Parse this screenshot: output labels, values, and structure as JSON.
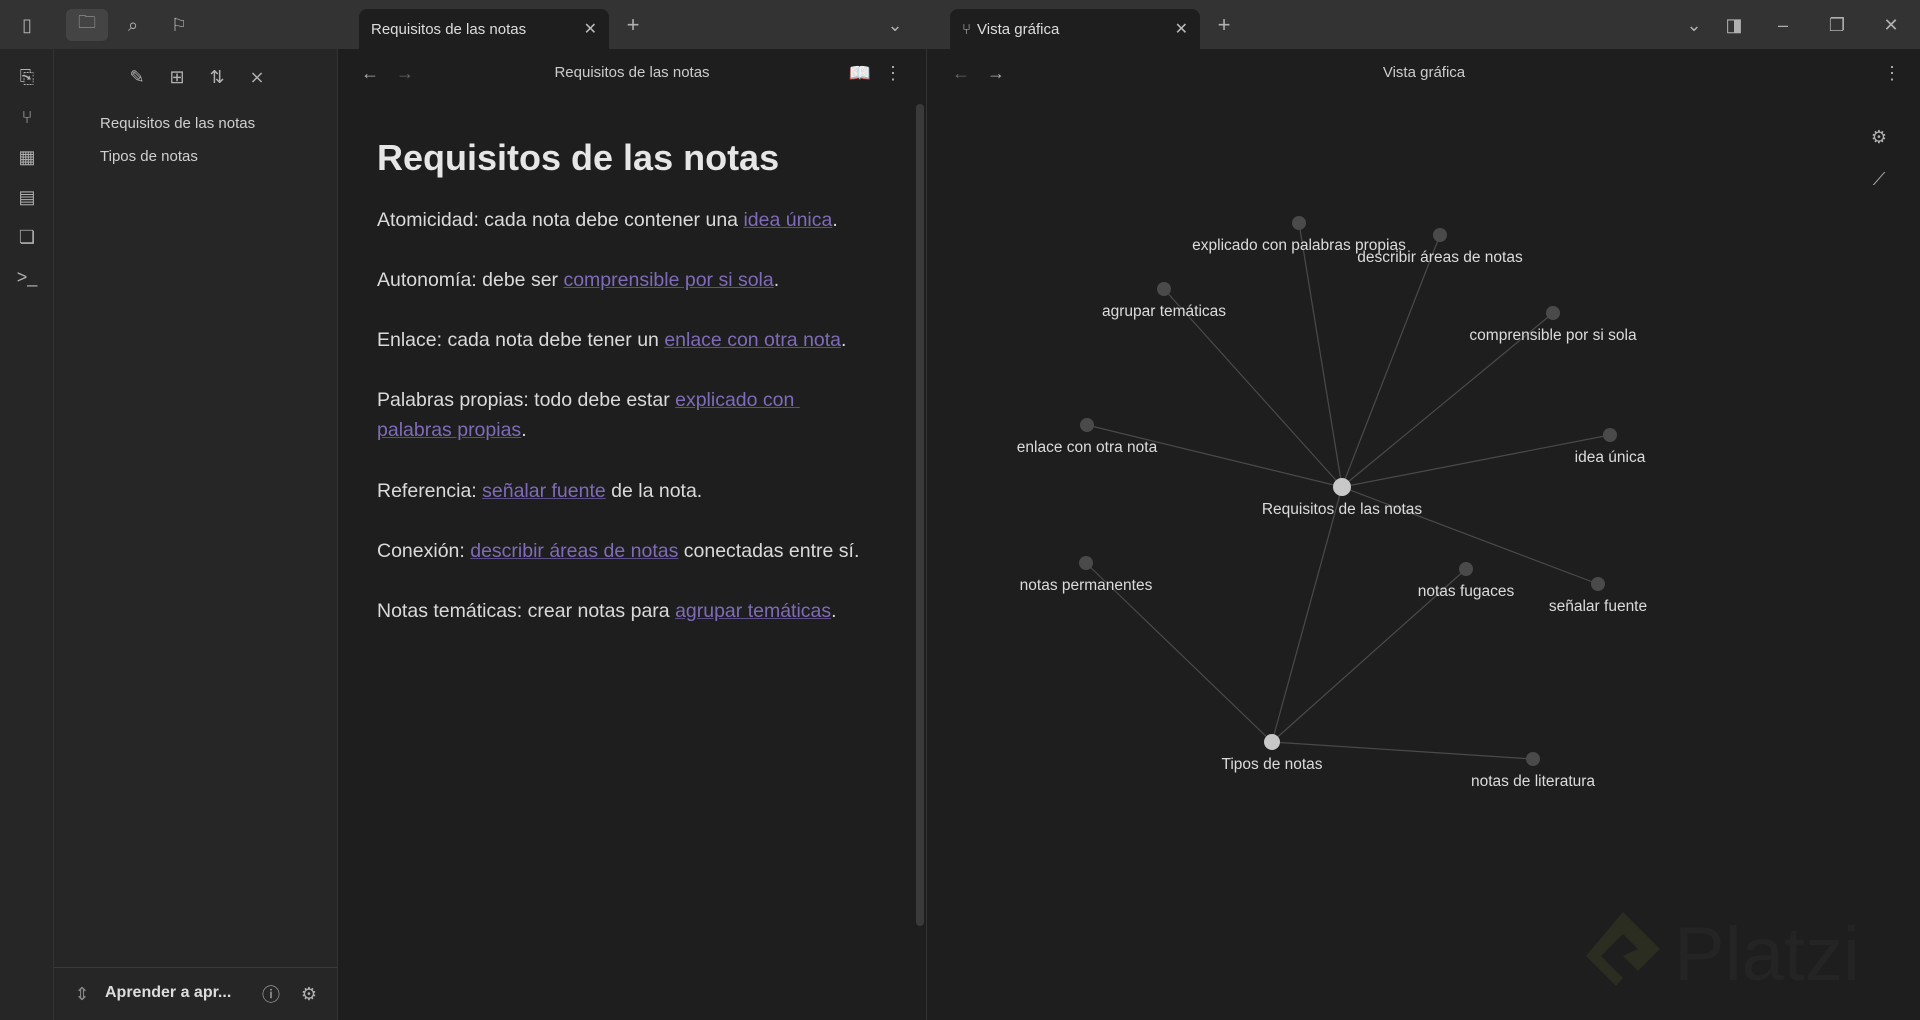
{
  "topbar": {
    "tabs": [
      {
        "label": "Requisitos de las notas"
      },
      {
        "label": "Vista gráfica"
      }
    ],
    "icons": [
      "sidebar-toggle-icon",
      "folder-icon",
      "search-icon",
      "bookmark-icon"
    ]
  },
  "sidebar": {
    "files": [
      {
        "label": "Requisitos de las notas"
      },
      {
        "label": "Tipos de notas"
      }
    ],
    "vault_name": "Aprender a apr..."
  },
  "editor": {
    "header_title": "Requisitos de las notas",
    "title": "Requisitos de las notas",
    "paragraphs": [
      {
        "pre": "Atomicidad: cada nota debe contener una ",
        "link": "idea única",
        "post": "."
      },
      {
        "pre": "Autonomía: debe ser ",
        "link": "comprensible por si sola",
        "post": "."
      },
      {
        "pre": "Enlace: cada nota debe tener un ",
        "link": "enlace con otra nota",
        "post": "."
      },
      {
        "pre": "Palabras propias: todo debe estar ",
        "link": "explicado con palabras propias",
        "post": "."
      },
      {
        "pre": "Referencia: ",
        "link": "señalar fuente",
        "post": " de la nota."
      },
      {
        "pre": "Conexión: ",
        "link": "describir áreas de notas",
        "post": " conectadas entre sí."
      },
      {
        "pre": "Notas temáticas: crear notas para ",
        "link": "agrupar temáticas",
        "post": "."
      }
    ]
  },
  "graph": {
    "header_title": "Vista gráfica",
    "nodes": [
      {
        "label": "Requisitos de las notas",
        "main": true
      },
      {
        "label": "Tipos de notas",
        "main": true
      },
      {
        "label": "explicado con palabras propias"
      },
      {
        "label": "describir áreas de notas"
      },
      {
        "label": "agrupar temáticas"
      },
      {
        "label": "comprensible por si sola"
      },
      {
        "label": "enlace con otra nota"
      },
      {
        "label": "idea única"
      },
      {
        "label": "notas permanentes"
      },
      {
        "label": "notas fugaces"
      },
      {
        "label": "señalar fuente"
      },
      {
        "label": "notas de literatura"
      }
    ],
    "edges": [
      [
        0,
        2
      ],
      [
        0,
        3
      ],
      [
        0,
        4
      ],
      [
        0,
        5
      ],
      [
        0,
        6
      ],
      [
        0,
        7
      ],
      [
        0,
        10
      ],
      [
        0,
        1
      ],
      [
        1,
        8
      ],
      [
        1,
        9
      ],
      [
        1,
        11
      ]
    ]
  },
  "watermark": "Platzi",
  "colors": {
    "link": "#7f6bb8",
    "node": "#4a4a4a",
    "main_node": "#c8c8c8"
  }
}
